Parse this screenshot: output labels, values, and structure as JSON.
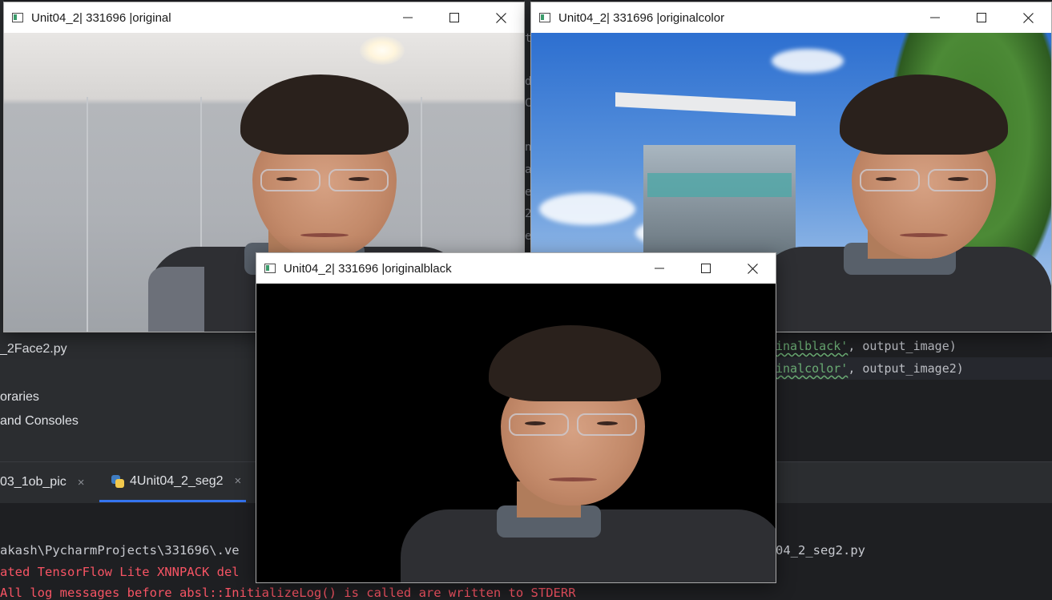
{
  "ide": {
    "project_items": [
      "_2Face2.py",
      "oraries",
      "and Consoles"
    ],
    "code_lines": [
      {
        "str": "inalblack'",
        "rest": ", output_image)"
      },
      {
        "str": "inalcolor'",
        "rest": ", output_image2)"
      }
    ],
    "gutter_chars": [
      "t",
      "d",
      "C",
      "n",
      "a",
      "e",
      "2",
      "e"
    ],
    "tabs": [
      {
        "label": "03_1ob_pic",
        "close": "×"
      },
      {
        "label": "4Unit04_2_seg2",
        "close": "×"
      }
    ],
    "console": {
      "path_line": "akash\\PycharmProjects\\331696\\.ve",
      "path_line_right": "04_2_seg2.py",
      "error_line": "ated TensorFlow Lite XNNPACK del",
      "error_line_2": "All log messages before absl::InitializeLog() is called are written to STDERR"
    }
  },
  "windows": {
    "original": {
      "title": "Unit04_2| 331696 |original"
    },
    "originalcolor": {
      "title": "Unit04_2| 331696 |originalcolor"
    },
    "originalblack": {
      "title": "Unit04_2| 331696 |originalblack"
    }
  },
  "icons": {
    "window_icon": "opencv-window-icon",
    "minimize": "minimize-icon",
    "maximize": "maximize-icon",
    "close": "close-icon",
    "python": "python-file-icon"
  }
}
